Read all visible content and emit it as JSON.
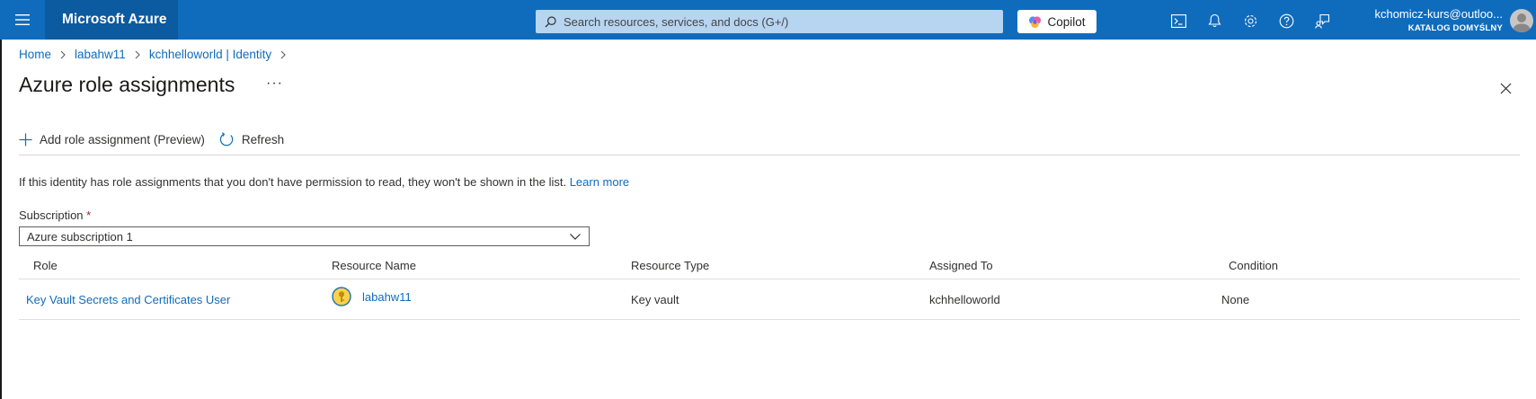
{
  "topbar": {
    "brand": "Microsoft Azure",
    "search_placeholder": "Search resources, services, and docs (G+/)",
    "copilot_label": "Copilot",
    "account_name": "kchomicz-kurs@outloo...",
    "account_directory": "KATALOG DOMYŚLNY",
    "accent_color": "#0f6cbd"
  },
  "breadcrumb": {
    "items": [
      "Home",
      "labahw11",
      "kchhelloworld | Identity"
    ]
  },
  "page": {
    "title": "Azure role assignments",
    "more_label": "···"
  },
  "commands": {
    "add_label": "Add role assignment (Preview)",
    "refresh_label": "Refresh"
  },
  "info": {
    "text": "If this identity has role assignments that you don't have permission to read, they won't be shown in the list. ",
    "link": "Learn more"
  },
  "subscription": {
    "label": "Subscription",
    "required_marker": "*",
    "selected": "Azure subscription 1"
  },
  "table": {
    "columns": [
      "Role",
      "Resource Name",
      "Resource Type",
      "Assigned To",
      "Condition"
    ],
    "rows": [
      {
        "role": "Key Vault Secrets and Certificates User",
        "resource_name": "labahw11",
        "resource_type": "Key vault",
        "assigned_to": "kchhelloworld",
        "condition": "None"
      }
    ]
  }
}
